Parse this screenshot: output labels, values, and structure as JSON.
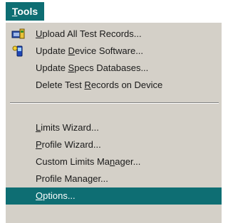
{
  "menubar": {
    "title_accel": "T",
    "title_rest": "ools"
  },
  "menu": {
    "group1": [
      {
        "pre": "",
        "accel": "U",
        "post": "pload All Test Records..."
      },
      {
        "pre": "Update ",
        "accel": "D",
        "post": "evice Software..."
      },
      {
        "pre": "Update ",
        "accel": "S",
        "post": "pecs Databases..."
      },
      {
        "pre": "Delete Test ",
        "accel": "R",
        "post": "ecords on Device"
      }
    ],
    "group2": [
      {
        "pre": "",
        "accel": "L",
        "post": "imits Wizard..."
      },
      {
        "pre": "",
        "accel": "P",
        "post": "rofile Wizard..."
      },
      {
        "pre": "Custom Limits Ma",
        "accel": "n",
        "post": "ager..."
      },
      {
        "pre": "Profile Manager...",
        "accel": "",
        "post": ""
      },
      {
        "pre": "",
        "accel": "O",
        "post": "ptions..."
      }
    ]
  },
  "icons": {
    "upload": "upload-records-icon",
    "update_device": "update-device-icon"
  },
  "colors": {
    "highlight": "#0e6e73",
    "menu_bg": "#d4d0c8",
    "text": "#1a1a1a"
  }
}
